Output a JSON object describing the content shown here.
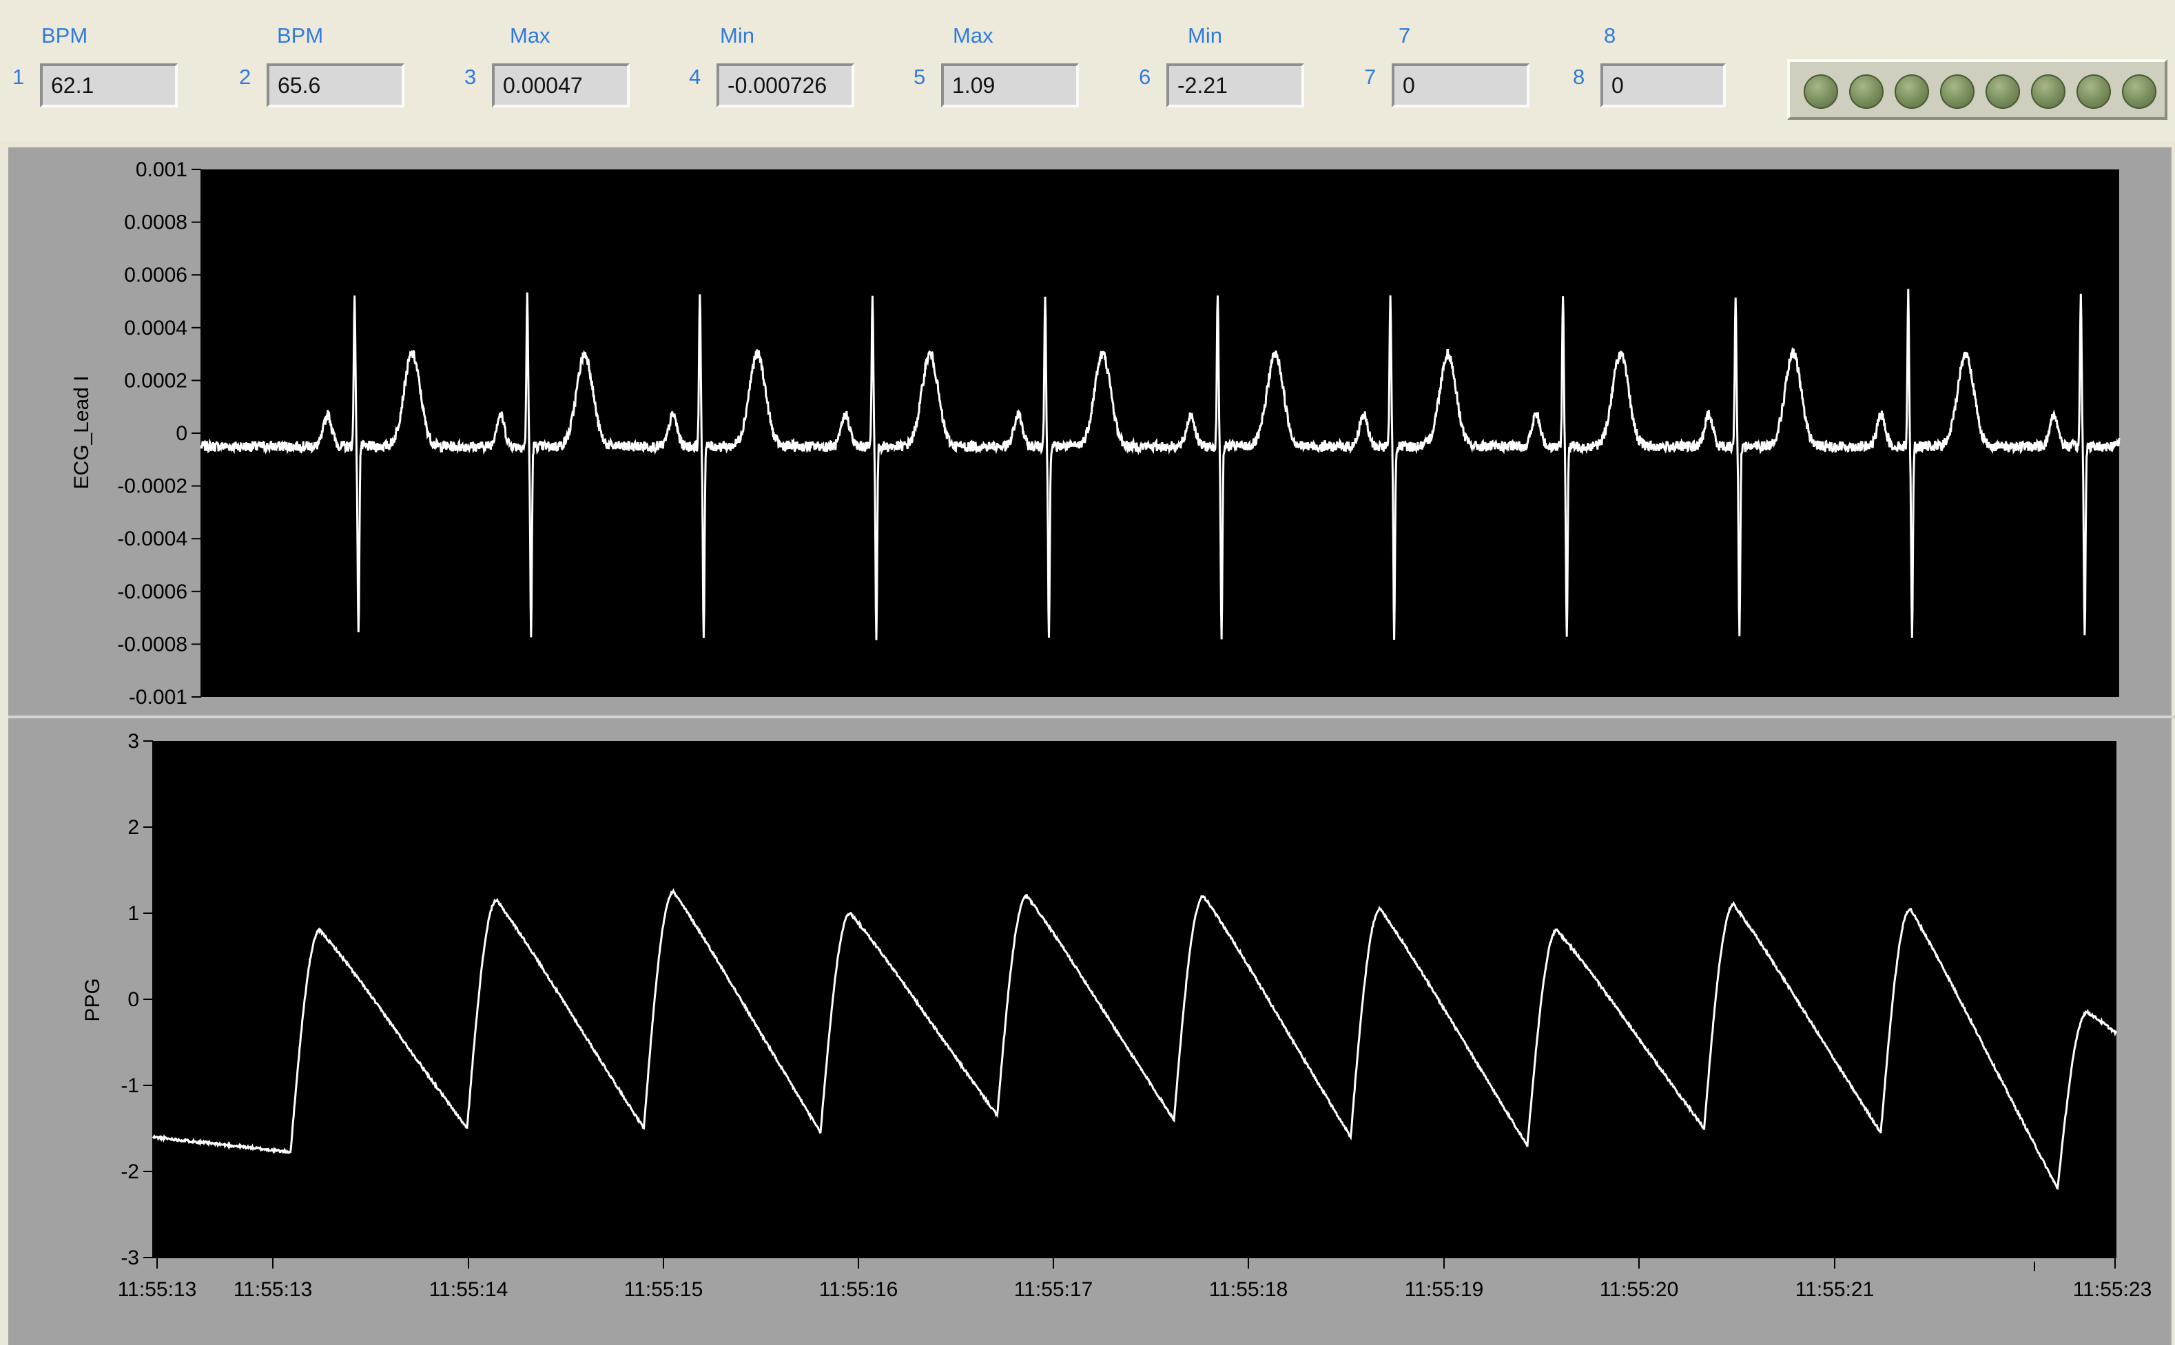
{
  "indicators": [
    {
      "index": "1",
      "label": "BPM",
      "value": "62.1"
    },
    {
      "index": "2",
      "label": "BPM",
      "value": "65.6"
    },
    {
      "index": "3",
      "label": "Max",
      "value": "0.00047"
    },
    {
      "index": "4",
      "label": "Min",
      "value": "-0.000726"
    },
    {
      "index": "5",
      "label": "Max",
      "value": "1.09"
    },
    {
      "index": "6",
      "label": "Min",
      "value": "-2.21"
    },
    {
      "index": "7",
      "label": "7",
      "value": "0"
    },
    {
      "index": "8",
      "label": "8",
      "value": "0"
    }
  ],
  "leds": {
    "count": 8,
    "state": "off",
    "color": "#7d9160"
  },
  "colors": {
    "plot_background": "#000000",
    "trace": "#ffffff",
    "label_text": "#2e7be0"
  },
  "chart_data": [
    {
      "type": "line",
      "ylabel": "ECG_Lead I",
      "ylim": [
        -0.001,
        0.001
      ],
      "y_ticks": [
        "0.001",
        "0.0008",
        "0.0006",
        "0.0004",
        "0.0002",
        "0",
        "-0.0002",
        "-0.0004",
        "-0.0006",
        "-0.0008",
        "-0.001"
      ],
      "grid": false,
      "beat_times_s": [
        0.8,
        1.7,
        2.6,
        3.5,
        4.4,
        5.3,
        6.2,
        7.1,
        8.0,
        8.9,
        9.8
      ],
      "series": [
        {
          "baseline": -5e-05,
          "r_peak": 0.00058,
          "s_trough": -0.00072,
          "t_peak": 0.00035
        }
      ]
    },
    {
      "type": "line",
      "ylabel": "PPG",
      "ylim": [
        -3,
        3
      ],
      "y_ticks": [
        "3",
        "2",
        "1",
        "0",
        "-1",
        "-2",
        "-3"
      ],
      "grid": false,
      "x_tick_labels": [
        "11:55:13",
        "11:55:13",
        "11:55:14",
        "11:55:15",
        "11:55:16",
        "11:55:17",
        "11:55:18",
        "11:55:19",
        "11:55:20",
        "11:55:21",
        "11:55:23"
      ],
      "pulse_times_s": [
        0.8,
        1.7,
        2.6,
        3.5,
        4.4,
        5.3,
        6.2,
        7.1,
        8.0,
        8.9,
        9.8
      ],
      "pulse_peaks": [
        0.8,
        1.15,
        1.25,
        1.0,
        1.2,
        1.2,
        1.05,
        0.8,
        1.1,
        1.05,
        -0.15
      ],
      "pulse_troughs": [
        -1.8,
        -1.5,
        -1.5,
        -1.55,
        -1.35,
        -1.4,
        -1.6,
        -1.7,
        -1.5,
        -1.55,
        -2.2
      ]
    }
  ]
}
